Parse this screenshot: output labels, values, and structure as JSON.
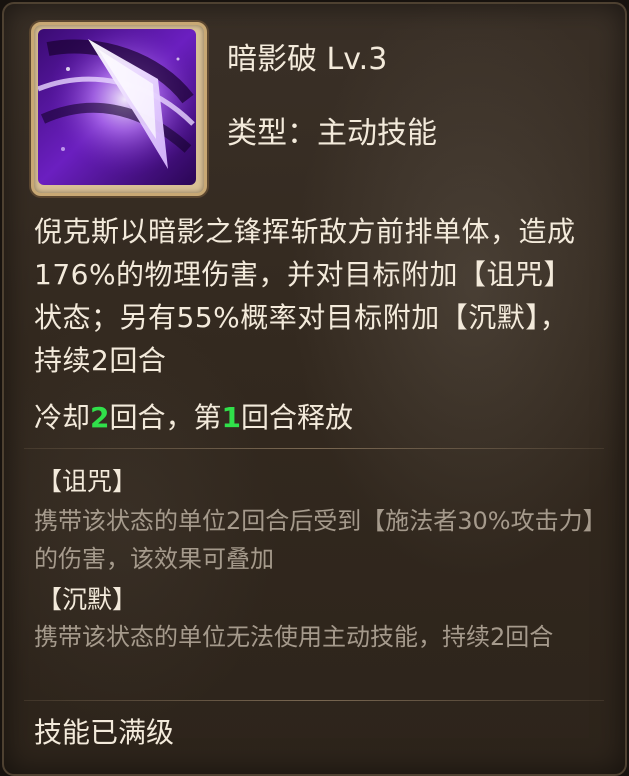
{
  "skill": {
    "icon": "shadow-slash-icon",
    "name": "暗影破 Lv.3",
    "type": "类型：主动技能",
    "description": "倪克斯以暗影之锋挥斩敌方前排单体，造成176%的物理伤害，并对目标附加【诅咒】状态；另有55%概率对目标附加【沉默】，持续2回合",
    "cooldown": {
      "prefix": "冷却",
      "value1": "2",
      "middle": "回合，第",
      "value2": "1",
      "suffix": "回合释放"
    },
    "statuses": [
      {
        "title": "【诅咒】",
        "description": "携带该状态的单位2回合后受到【施法者30%攻击力】的伤害，该效果可叠加"
      },
      {
        "title": "【沉默】",
        "description": "携带该状态的单位无法使用主动技能，持续2回合"
      }
    ],
    "max_level_text": "技能已满级"
  },
  "colors": {
    "text": "#f3eadb",
    "muted": "#a59a8c",
    "highlight": "#30e04a",
    "frame": "#c8a874"
  }
}
